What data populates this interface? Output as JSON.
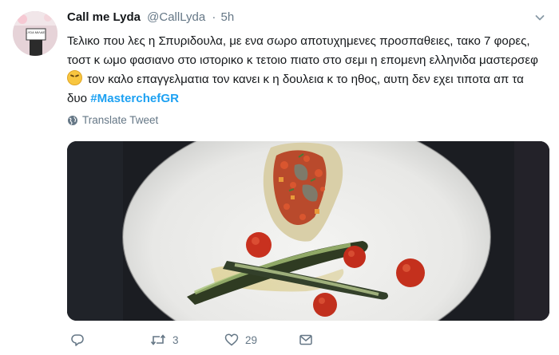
{
  "tweet": {
    "author_name": "Call me Lyda",
    "author_handle": "@CallLyda",
    "separator": "·",
    "time": "5h",
    "text_main": "Τελικο που λες η Σπυριδουλα, με ενα σωρο αποτυχημενες προσπαθειες, τακο 7 φορες, τοστ κ ωμο φασιανο στο ιστορικο κ τετοιο πιατο στο σεμι η επομενη ελληνιδα μαστερσεφ",
    "text_after_emoji": " τον καλο επαγγελματια τον κανει κ η δουλεια κ το ηθος, αυτη δεν εχει τιποτα απ τα δυο ",
    "hashtag": "#MasterchefGR",
    "emoji_name": "crying-laughing-emoji",
    "translate_label": "Translate Tweet",
    "retweet_count": "3",
    "like_count": "29",
    "avatar_sign_text": "LYDA ΜΙΛΑΕΙ"
  },
  "colors": {
    "link_blue": "#1da1f2",
    "meta_gray": "#657786"
  },
  "icons": [
    "chevron-down-icon",
    "globe-icon",
    "reply-icon",
    "retweet-icon",
    "like-icon",
    "message-icon"
  ]
}
